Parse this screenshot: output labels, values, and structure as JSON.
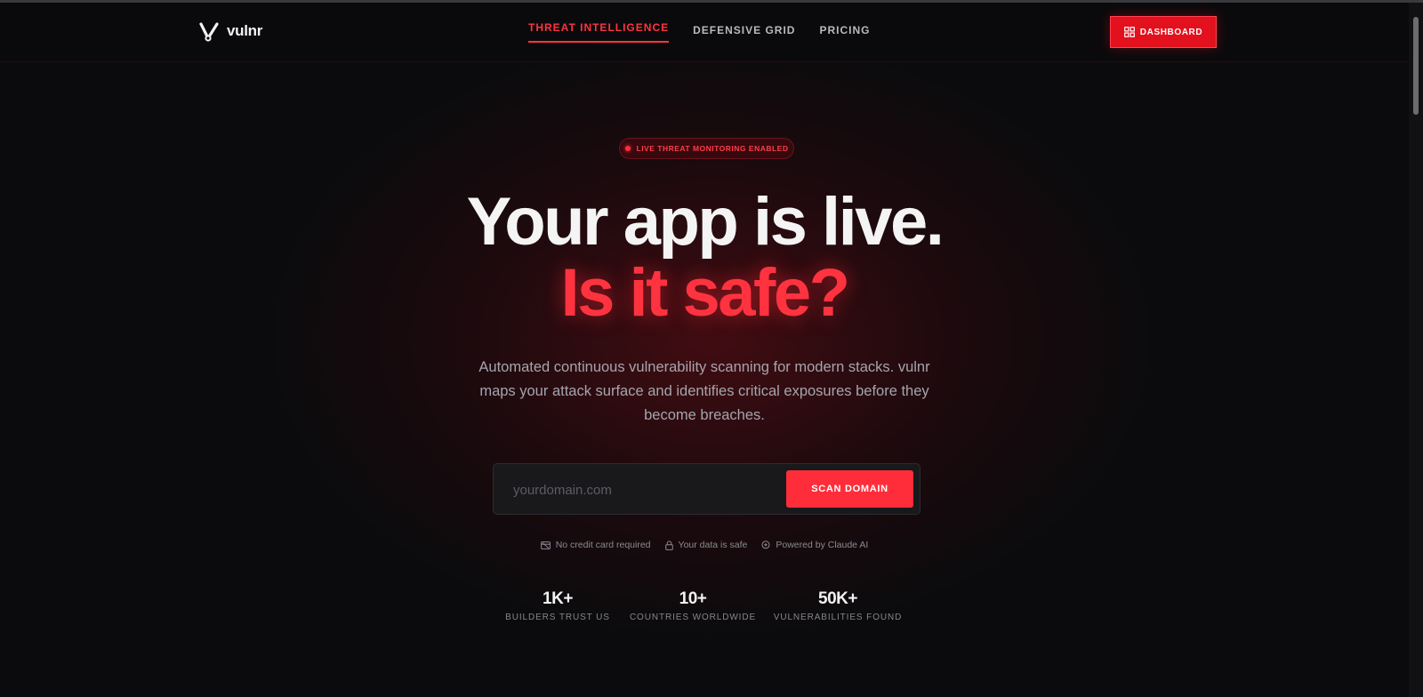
{
  "nav": {
    "brand": "vulnr",
    "links": [
      {
        "label": "THREAT INTELLIGENCE"
      },
      {
        "label": "DEFENSIVE GRID"
      },
      {
        "label": "PRICING"
      }
    ],
    "dashboard_label": "DASHBOARD"
  },
  "hero": {
    "badge": "LIVE THREAT MONITORING ENABLED",
    "headline_line1": "Your app is live.",
    "headline_line2": "Is it safe?",
    "subtext": "Automated continuous vulnerability scanning for modern stacks. vulnr maps your attack surface and identifies critical exposures before they become breaches.",
    "input_placeholder": "yourdomain.com",
    "scan_label": "SCAN DOMAIN"
  },
  "trust": [
    {
      "icon": "credit-card-icon",
      "label": "No credit card required"
    },
    {
      "icon": "lock-icon",
      "label": "Your data is safe"
    },
    {
      "icon": "sparkle-icon",
      "label": "Powered by Claude AI"
    }
  ],
  "stats": [
    {
      "value": "1K+",
      "label": "BUILDERS TRUST US"
    },
    {
      "value": "10+",
      "label": "COUNTRIES WORLDWIDE"
    },
    {
      "value": "50K+",
      "label": "VULNERABILITIES FOUND"
    }
  ],
  "colors": {
    "accent": "#ff3340",
    "button": "#e3101d",
    "background": "#0b0b0d"
  }
}
